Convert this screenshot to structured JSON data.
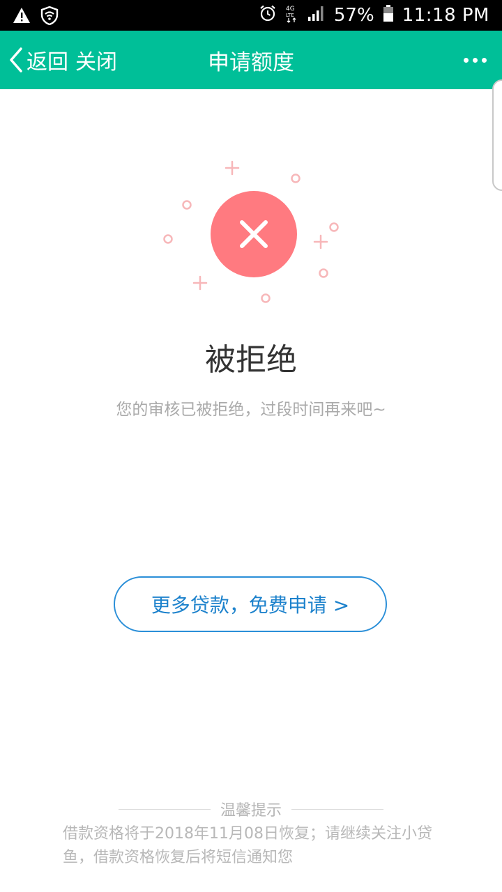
{
  "status_bar": {
    "battery": "57%",
    "time": "11:18 PM",
    "network": "4G LTE"
  },
  "nav": {
    "back_label": "返回",
    "close_label": "关闭",
    "title": "申请额度",
    "background_color": "#00bf98"
  },
  "result": {
    "icon": "reject-x-icon",
    "icon_color": "#ff7a80",
    "title": "被拒绝",
    "description": "您的审核已被拒绝，过段时间再来吧~"
  },
  "apply_button": {
    "label": "更多贷款，免费申请 >",
    "color": "#1d82cc"
  },
  "tips": {
    "heading": "温馨提示",
    "text": "借款资格将于2018年11月08日恢复；请继续关注小贷鱼，借款资格恢复后将短信通知您"
  }
}
